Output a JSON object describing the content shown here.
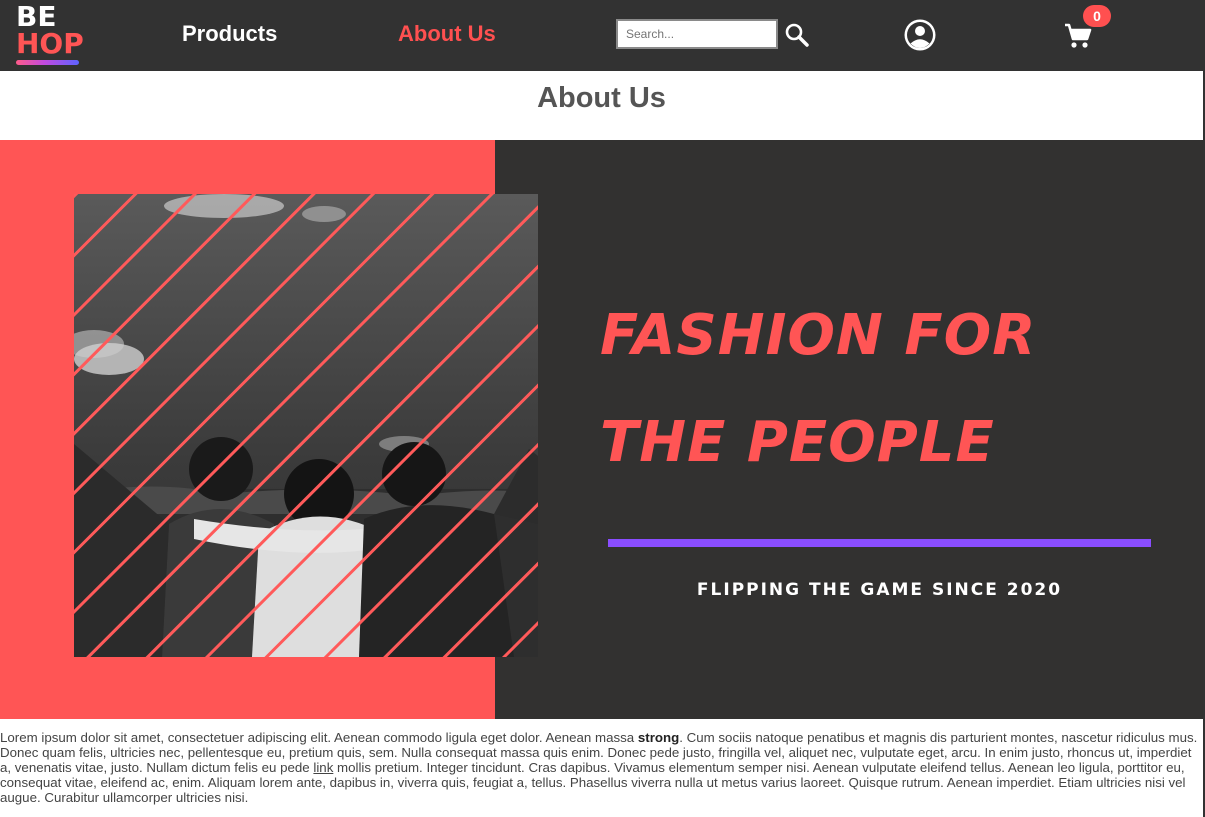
{
  "logo": {
    "line1": "BE",
    "line2": "HOP"
  },
  "nav": {
    "products": "Products",
    "about": "About Us"
  },
  "search": {
    "placeholder": "Search...",
    "icon": "search-icon"
  },
  "account": {
    "icon": "account-circle-icon"
  },
  "cart": {
    "icon": "shopping-cart-icon",
    "count": "0"
  },
  "page": {
    "title": "About Us"
  },
  "hero": {
    "heading": "FASHION FOR THE PEOPLE",
    "tagline": "FLIPPING THE GAME SINCE 2020"
  },
  "body": {
    "part1": "Lorem ipsum dolor sit amet, consectetuer adipiscing elit. Aenean commodo ligula eget dolor. Aenean massa ",
    "strong": "strong",
    "part2": ". Cum sociis natoque penatibus et magnis dis parturient montes, nascetur ridiculus mus. Donec quam felis, ultricies nec, pellentesque eu, pretium quis, sem. Nulla consequat massa quis enim. Donec pede justo, fringilla vel, aliquet nec, vulputate eget, arcu. In enim justo, rhoncus ut, imperdiet a, venenatis vitae, justo. Nullam dictum felis eu pede ",
    "link": "link",
    "part3": " mollis pretium. Integer tincidunt. Cras dapibus. Vivamus elementum semper nisi. Aenean vulputate eleifend tellus. Aenean leo ligula, porttitor eu, consequat vitae, eleifend ac, enim. Aliquam lorem ante, dapibus in, viverra quis, feugiat a, tellus. Phasellus viverra nulla ut metus varius laoreet. Quisque rutrum. Aenean imperdiet. Etiam ultricies nisi vel augue. Curabitur ullamcorper ultricies nisi."
  },
  "colors": {
    "navbar": "#323232",
    "accent": "#ff5555",
    "hero_dark": "#323130",
    "divider": "#8a4dff"
  }
}
